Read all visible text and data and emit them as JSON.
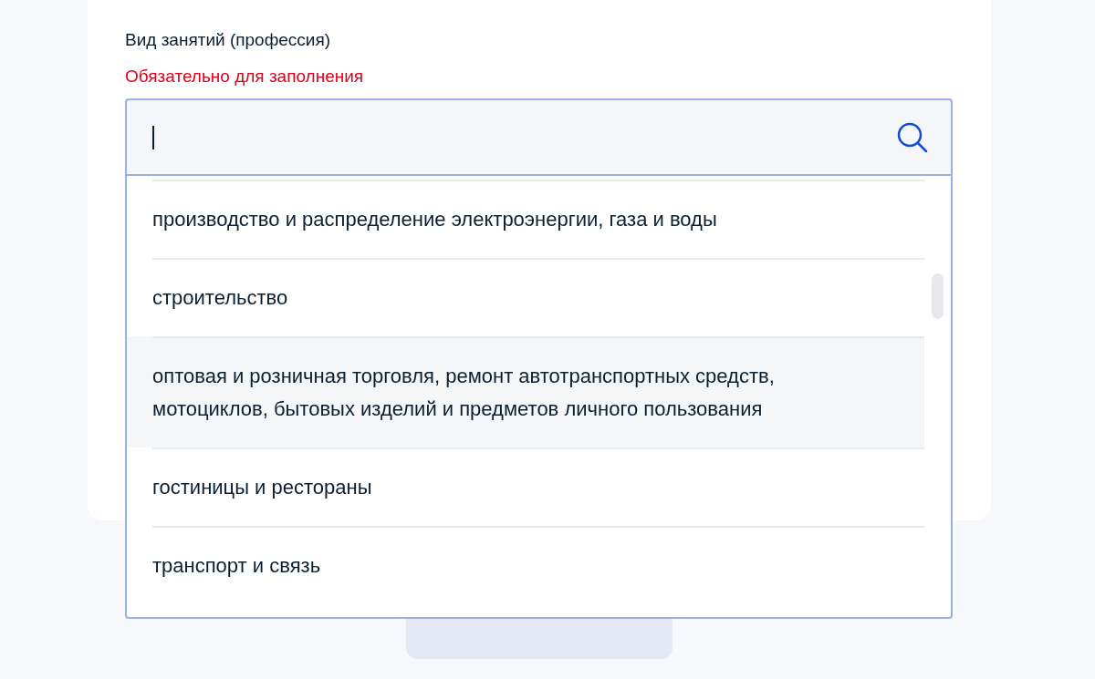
{
  "field": {
    "label": "Вид занятий (профессия)",
    "error": "Обязательно для заполнения",
    "focused": true
  },
  "options": [
    {
      "label": "производство и распределение электроэнергии, газа и воды",
      "highlighted": false
    },
    {
      "label": "строительство",
      "highlighted": false
    },
    {
      "label": "оптовая и розничная торговля, ремонт автотранспортных средств, мотоциклов, бытовых изделий и предметов личного пользования",
      "highlighted": true
    },
    {
      "label": "гостиницы и рестораны",
      "highlighted": false
    },
    {
      "label": "транспорт и связь",
      "highlighted": false
    }
  ],
  "button": {
    "disabled": true
  }
}
